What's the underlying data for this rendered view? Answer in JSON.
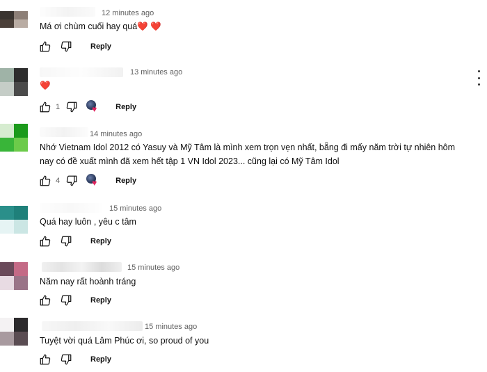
{
  "comments": [
    {
      "timestamp": "12 minutes ago",
      "text": "Má ơi chùm cuối hay quá",
      "emoji": "❤️ ❤️",
      "likes": "",
      "reply_label": "Reply"
    },
    {
      "timestamp": "13 minutes ago",
      "text": "",
      "emoji": "❤️",
      "likes": "1",
      "reply_label": "Reply",
      "creator_heart": true
    },
    {
      "timestamp": "14 minutes ago",
      "text": "Nhớ Vietnam Idol 2012 có Yasuy và Mỹ Tâm là mình xem trọn vẹn nhất, bẵng đi mấy năm trời tự nhiên hôm nay có đề xuất mình đã xem hết tập 1 VN Idol 2023... cũng lại có Mỹ Tâm Idol",
      "emoji": "",
      "likes": "4",
      "reply_label": "Reply",
      "creator_heart": true
    },
    {
      "timestamp": "15 minutes ago",
      "text": "Quá hay luôn , yêu c tâm",
      "emoji": "",
      "likes": "",
      "reply_label": "Reply"
    },
    {
      "timestamp": "15 minutes ago",
      "text": "Năm nay rất hoành tráng",
      "emoji": "",
      "likes": "",
      "reply_label": "Reply"
    },
    {
      "timestamp": "15 minutes ago",
      "text": "Tuyệt vời quá Lâm Phúc ơi, so proud of you",
      "emoji": "",
      "likes": "",
      "reply_label": "Reply"
    }
  ],
  "icons": {
    "like": "thumbs-up-icon",
    "dislike": "thumbs-down-icon",
    "more": "more-vert-icon",
    "creator_heart": "creator-heart-icon"
  },
  "colors": {
    "heart": "#e0245e",
    "timestamp": "#606060",
    "text": "#0f0f0f"
  }
}
